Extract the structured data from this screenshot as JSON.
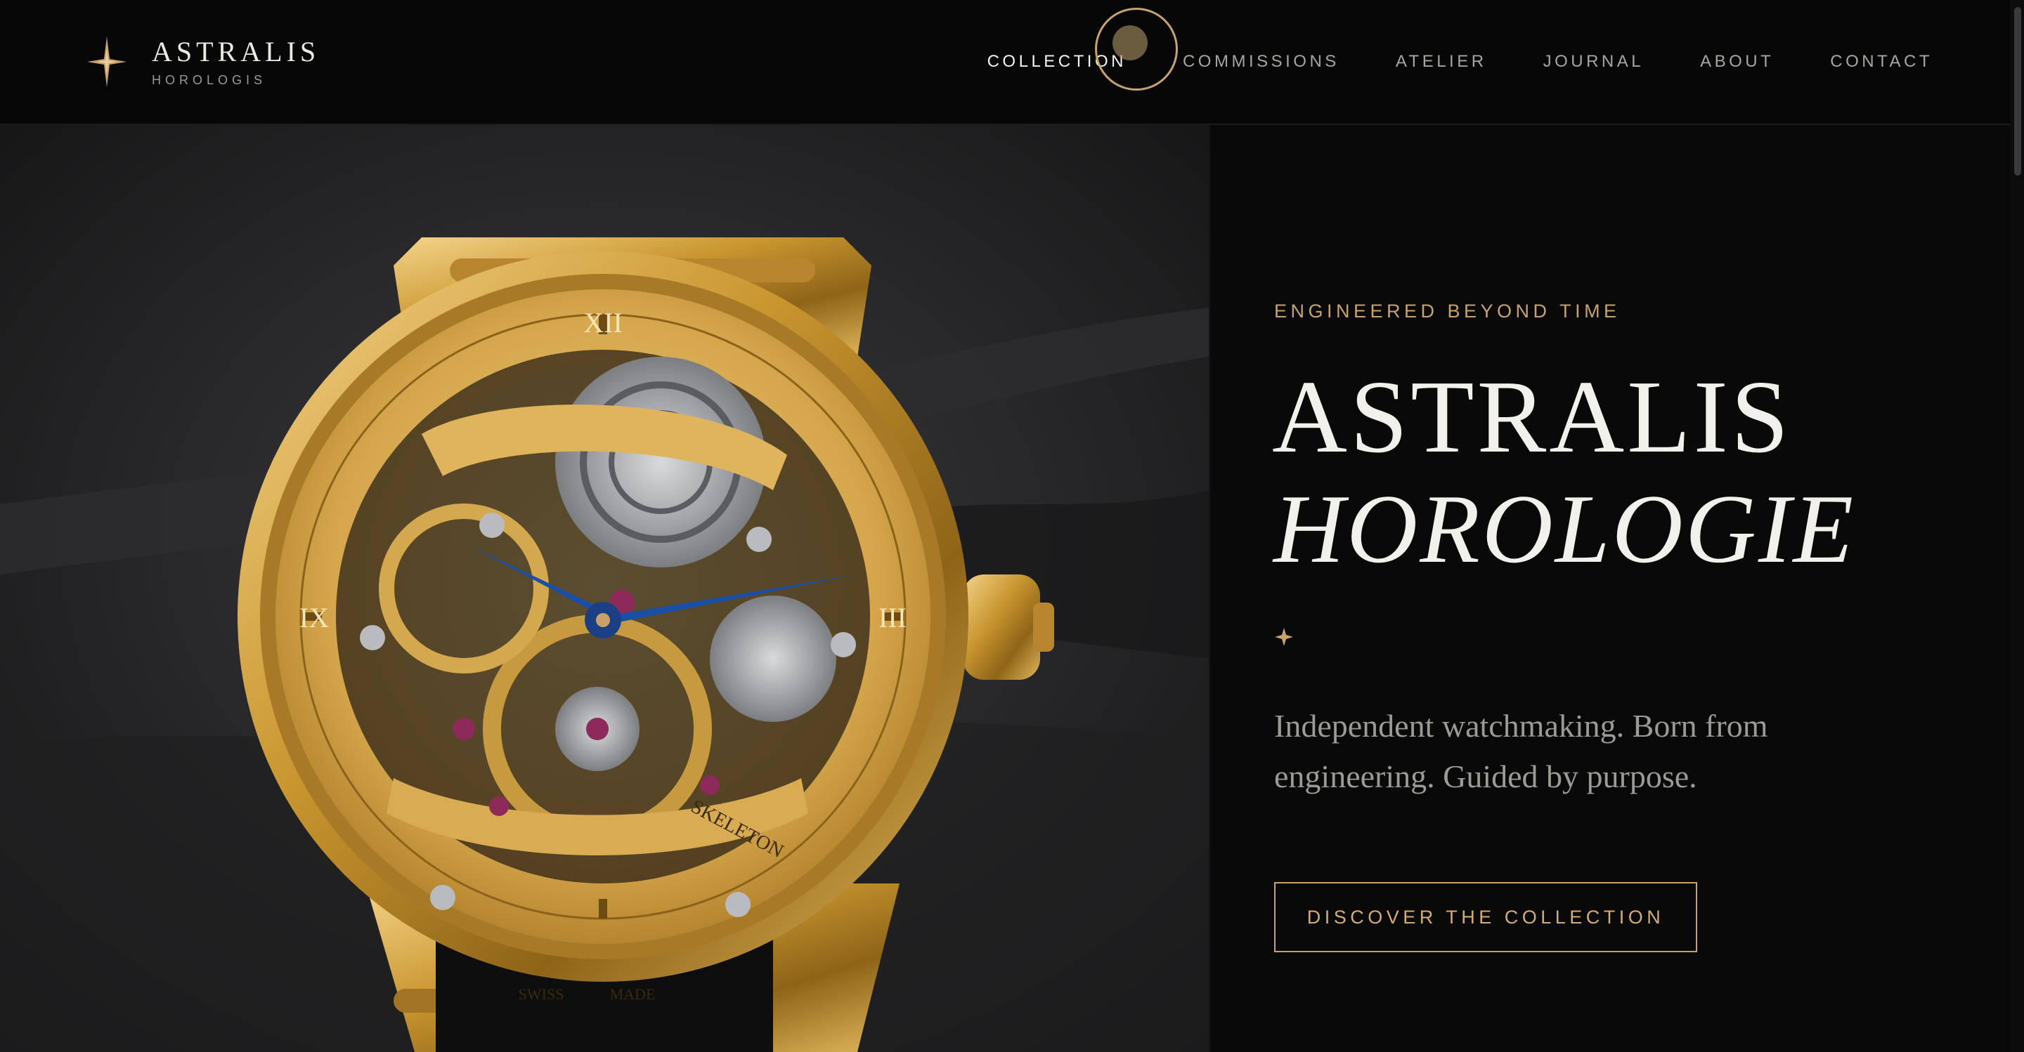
{
  "brand": {
    "name": "ASTRALIS",
    "subtitle": "HOROLOGIS"
  },
  "nav": {
    "items": [
      {
        "label": "COLLECTION",
        "active": true
      },
      {
        "label": "COMMISSIONS",
        "active": false
      },
      {
        "label": "ATELIER",
        "active": false
      },
      {
        "label": "JOURNAL",
        "active": false
      },
      {
        "label": "ABOUT",
        "active": false
      },
      {
        "label": "CONTACT",
        "active": false
      }
    ]
  },
  "hero": {
    "image_subject": "gold skeleton wristwatch on dark slate",
    "watch_dial": {
      "top_numeral": "XII",
      "left_numeral": "IX",
      "right_numeral": "III",
      "movement_label": "SKELETON",
      "bottom_left": "SWISS",
      "bottom_right": "MADE"
    },
    "eyebrow": "ENGINEERED BEYOND TIME",
    "title_line1": "ASTRALIS",
    "title_line2": "HOROLOGIE",
    "tagline_line1": "Independent watchmaking. Born from",
    "tagline_line2": "engineering. Guided by purpose.",
    "cta_label": "DISCOVER THE COLLECTION"
  },
  "colors": {
    "background": "#09090a",
    "accent_gold": "#c9a26b",
    "text_primary": "#f2f0ea",
    "text_muted": "#9c9a94",
    "watch_hands": "#1a4fa8"
  }
}
